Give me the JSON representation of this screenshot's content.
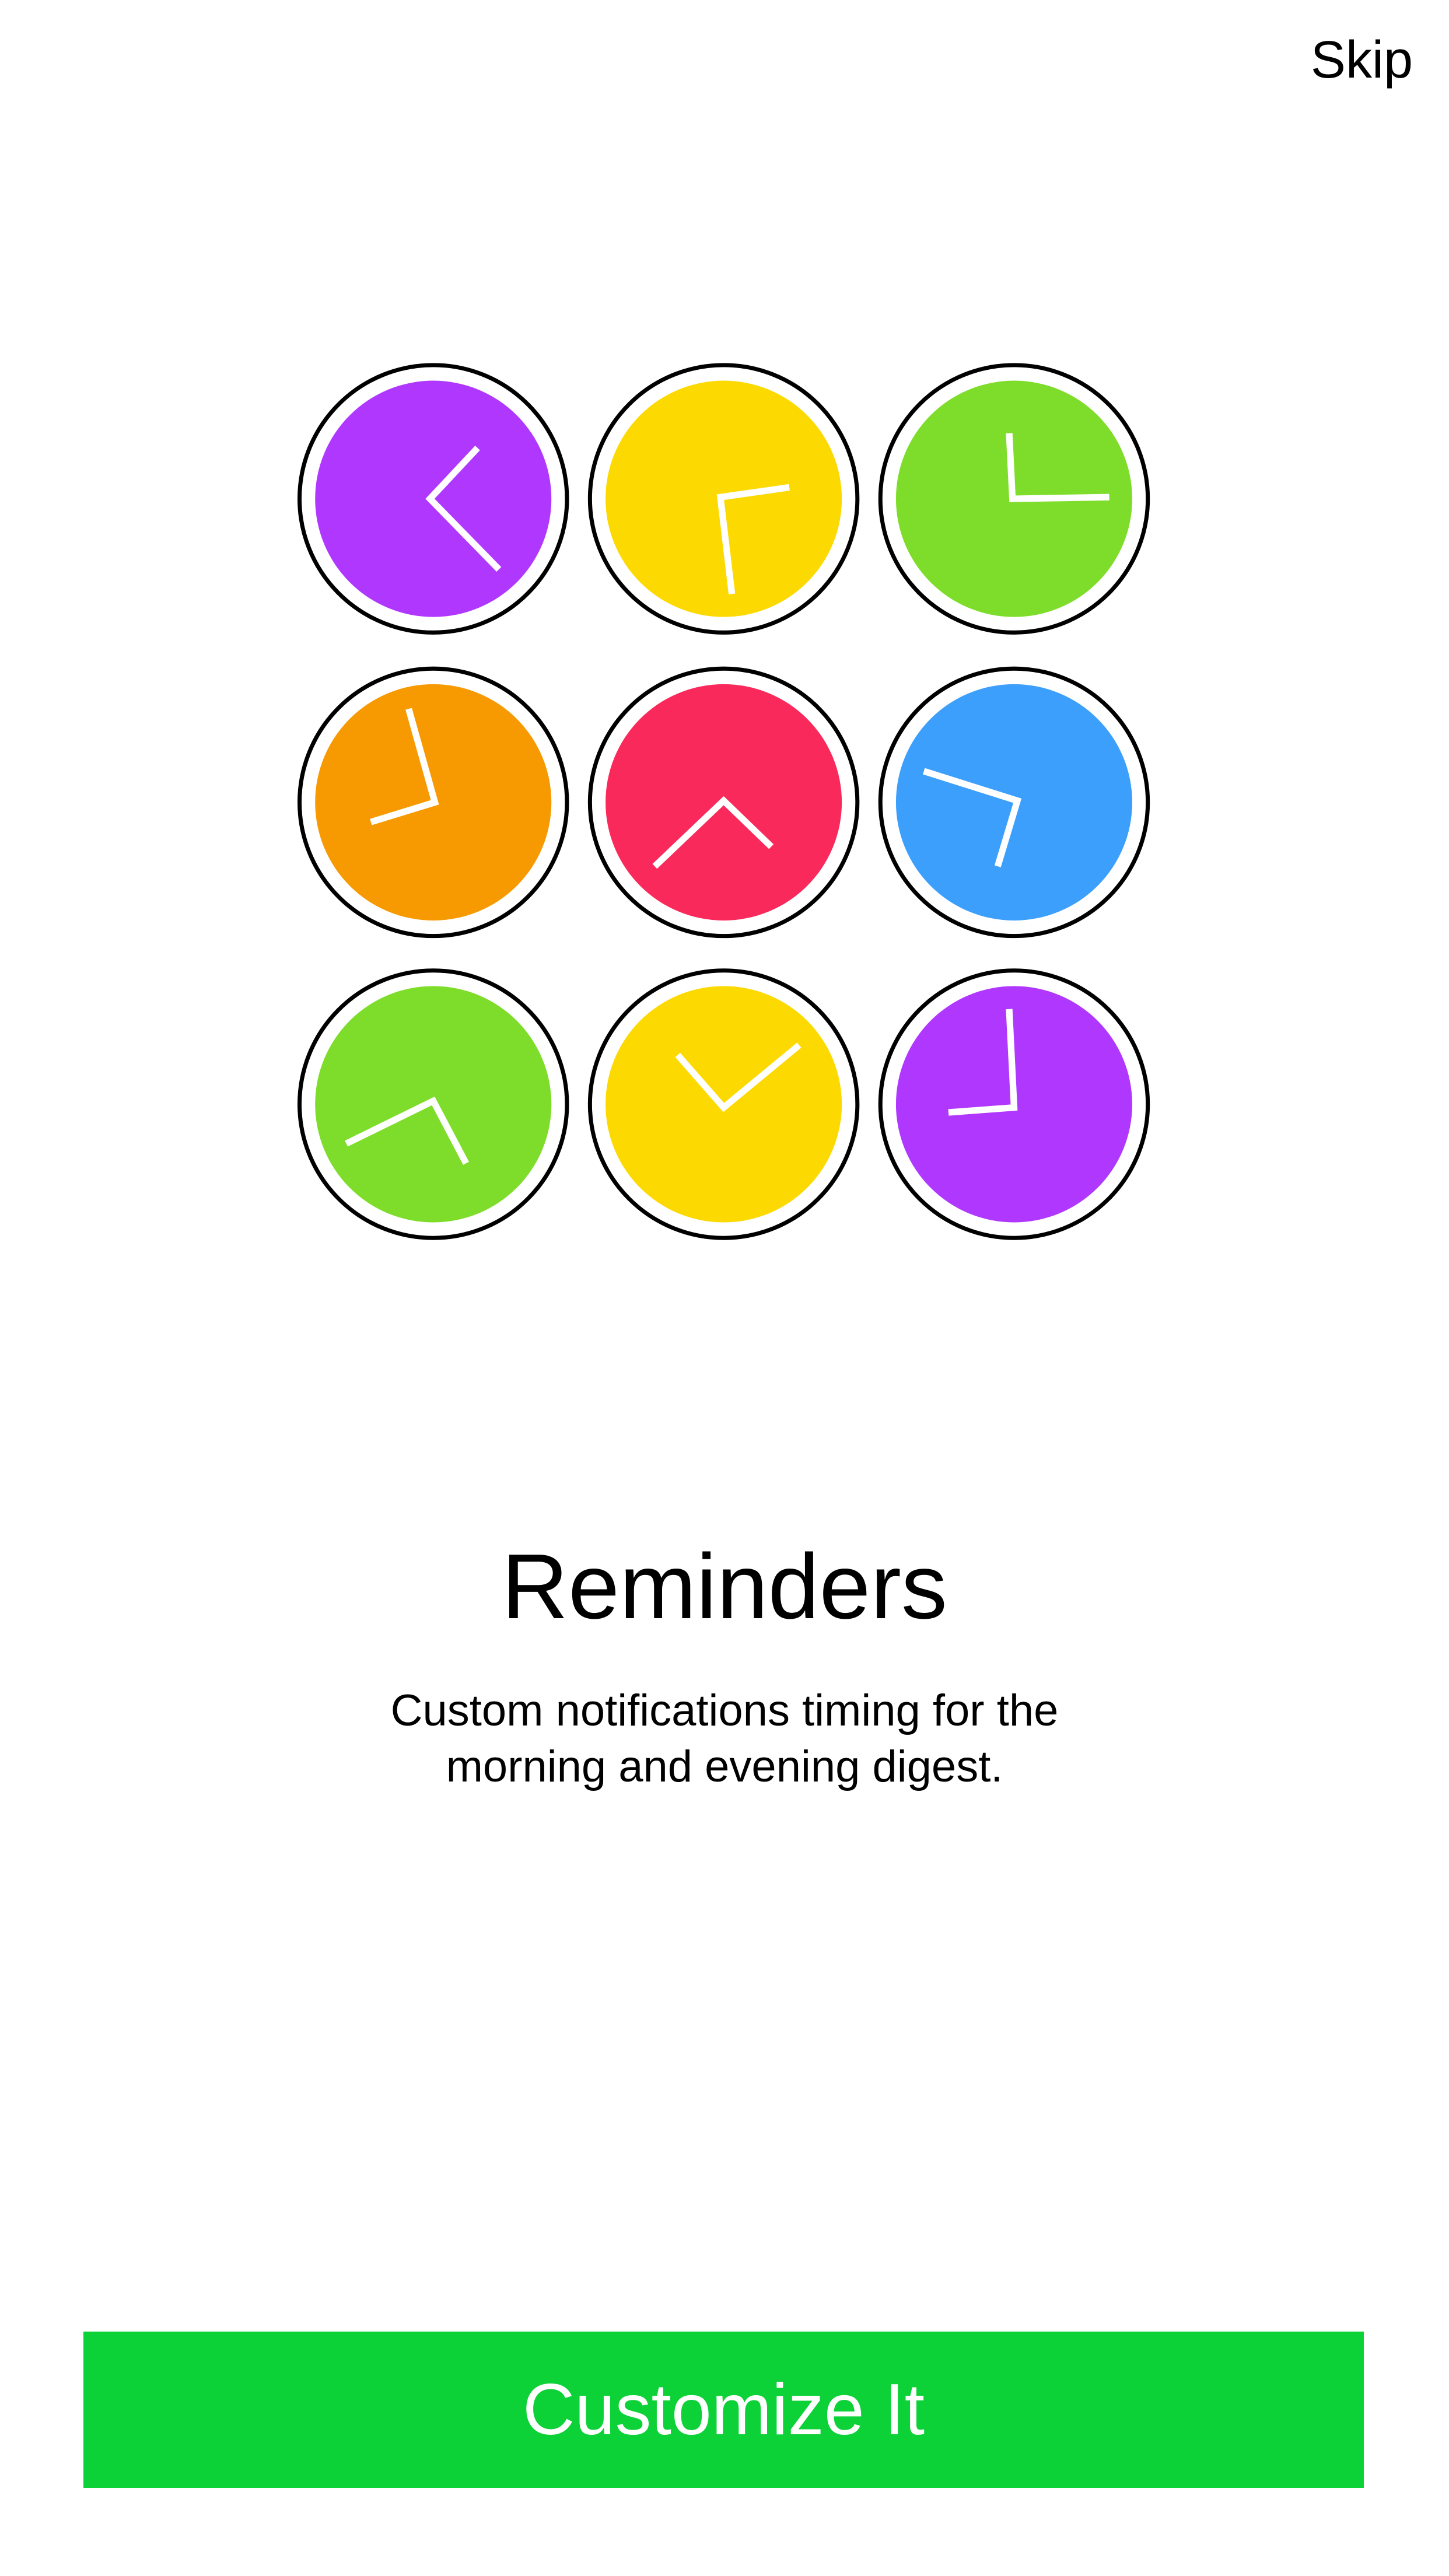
{
  "header": {
    "skip_label": "Skip"
  },
  "clocks": [
    {
      "color": "#B038FE"
    },
    {
      "color": "#FCD900"
    },
    {
      "color": "#7EDD2A"
    },
    {
      "color": "#F79A02"
    },
    {
      "color": "#F92A5B"
    },
    {
      "color": "#3C9FFB"
    },
    {
      "color": "#7EDD2A"
    },
    {
      "color": "#FCD900"
    },
    {
      "color": "#B038FE"
    }
  ],
  "content": {
    "title": "Reminders",
    "subtitle_line1": "Custom notifications timing for the",
    "subtitle_line2": "morning and evening digest."
  },
  "cta": {
    "label": "Customize It",
    "color": "#0CD137"
  }
}
